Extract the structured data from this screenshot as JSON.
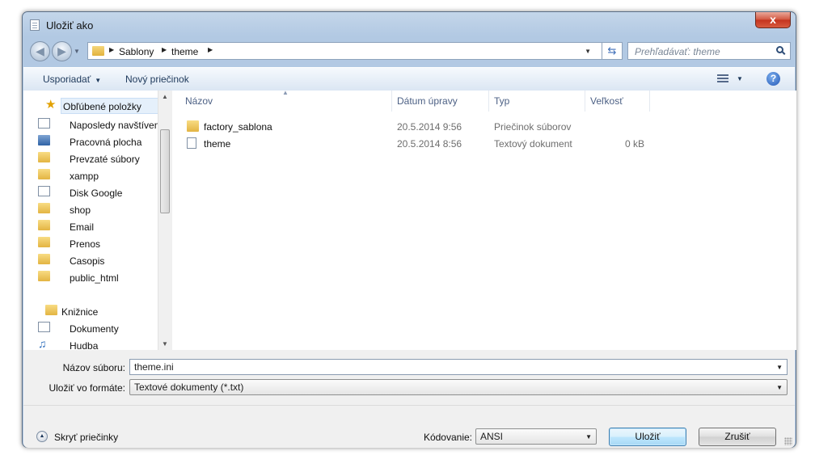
{
  "window": {
    "title": "Uložiť ako",
    "close_glyph": "x"
  },
  "address": {
    "crumbs": [
      "Sablony",
      "theme"
    ],
    "search_placeholder": "Prehľadávať: theme"
  },
  "toolbar": {
    "organize": "Usporiadať",
    "new_folder": "Nový priečinok",
    "help_glyph": "?"
  },
  "nav": {
    "favorites": "Obľúbené položky",
    "items": [
      {
        "label": "Naposledy navštívené",
        "icon": "recent-places-icon"
      },
      {
        "label": "Pracovná plocha",
        "icon": "desktop-icon"
      },
      {
        "label": "Prevzaté súbory",
        "icon": "downloads-icon"
      },
      {
        "label": "xampp",
        "icon": "folder-icon"
      },
      {
        "label": "Disk Google",
        "icon": "google-drive-icon"
      },
      {
        "label": "shop",
        "icon": "folder-icon"
      },
      {
        "label": "Email",
        "icon": "folder-icon"
      },
      {
        "label": "Prenos",
        "icon": "folder-icon"
      },
      {
        "label": "Casopis",
        "icon": "folder-icon"
      },
      {
        "label": "public_html",
        "icon": "folder-icon"
      }
    ],
    "libraries": "Knižnice",
    "library_items": [
      {
        "label": "Dokumenty",
        "icon": "documents-icon"
      },
      {
        "label": "Hudba",
        "icon": "music-icon"
      }
    ]
  },
  "columns": {
    "name": "Názov",
    "date": "Dátum úpravy",
    "type": "Typ",
    "size": "Veľkosť"
  },
  "files": [
    {
      "name": "factory_sablona",
      "date": "20.5.2014 9:56",
      "type": "Priečinok súborov",
      "size": "",
      "icon": "folder-icon"
    },
    {
      "name": "theme",
      "date": "20.5.2014 8:56",
      "type": "Textový dokument",
      "size": "0 kB",
      "icon": "text-file-icon"
    }
  ],
  "form": {
    "filename_label": "Názov súboru:",
    "filename_value": "theme.ini",
    "format_label": "Uložiť vo formáte:",
    "format_value": "Textové dokumenty (*.txt)",
    "encoding_label": "Kódovanie:",
    "encoding_value": "ANSI",
    "hide_folders": "Skryť priečinky",
    "save": "Uložiť",
    "cancel": "Zrušiť"
  },
  "colors": {
    "frame": "#b8cde6",
    "default_button": "#bee6fd"
  }
}
